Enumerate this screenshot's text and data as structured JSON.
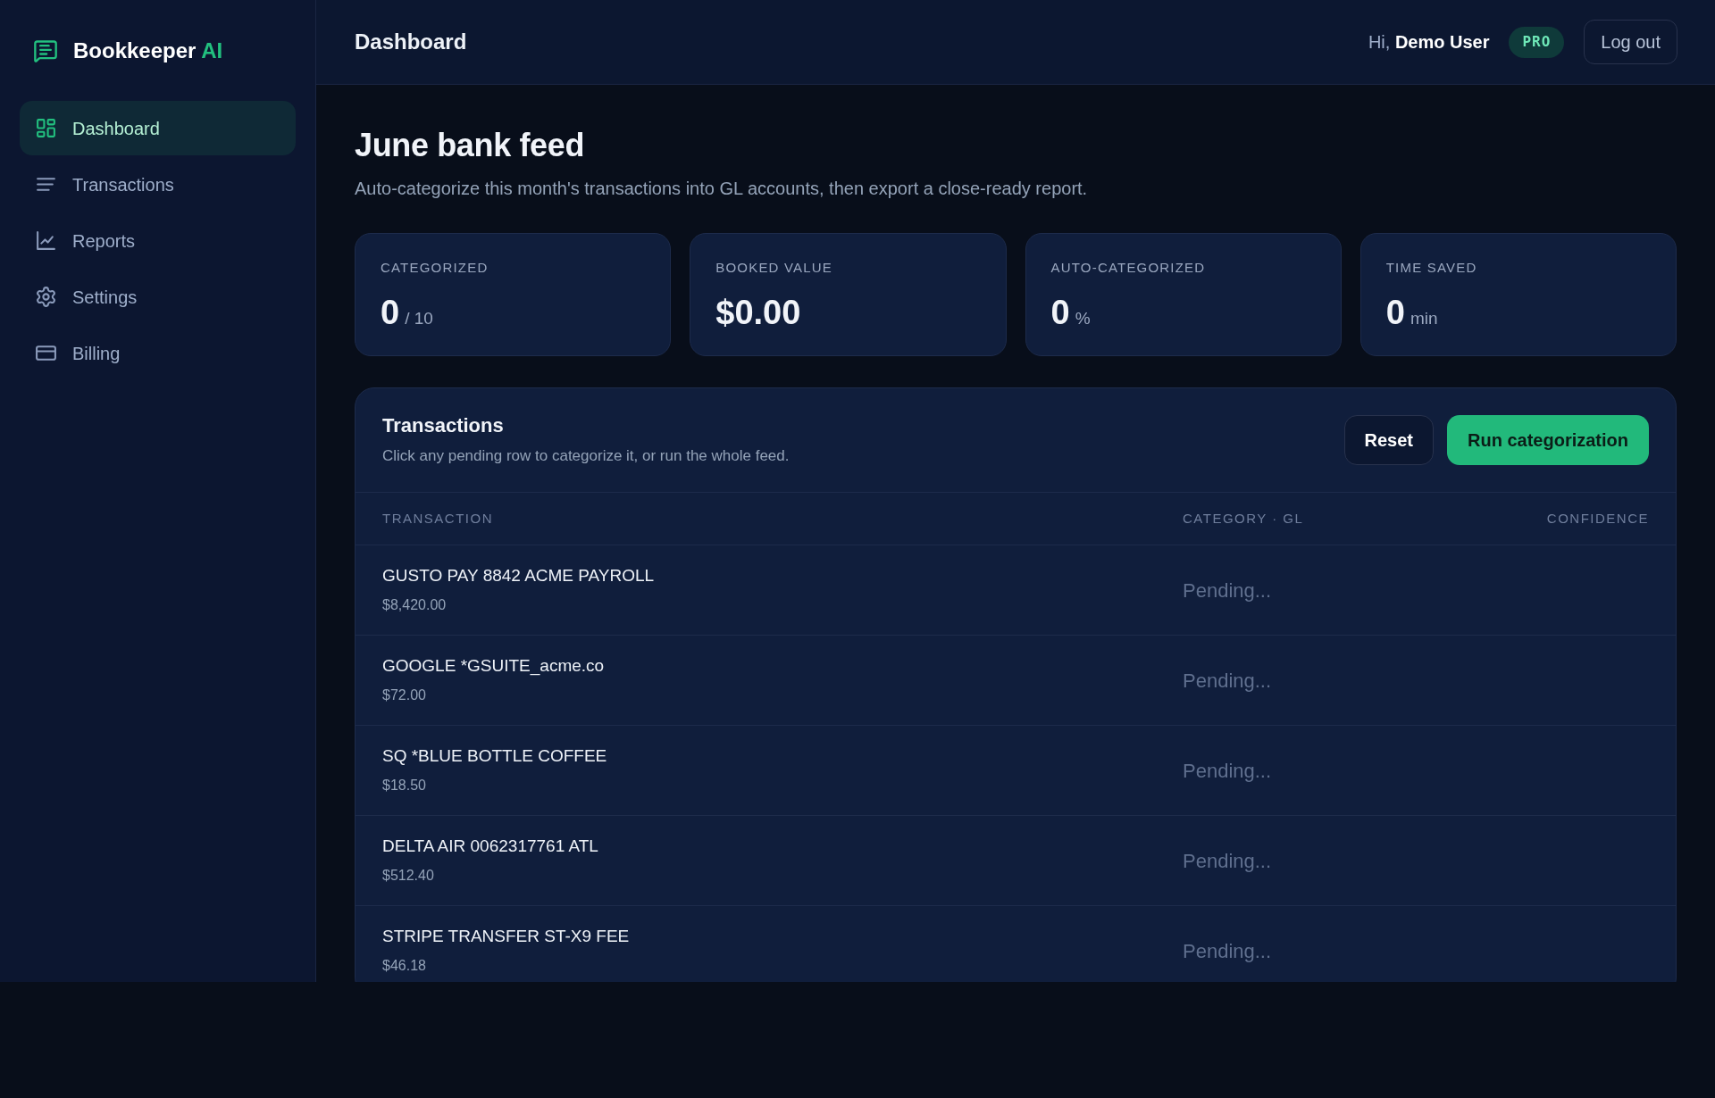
{
  "sidebar": {
    "brand": {
      "name": "Bookkeeper",
      "accent": "AI"
    },
    "items": [
      {
        "label": "Dashboard",
        "selected": true
      },
      {
        "label": "Transactions",
        "selected": false
      },
      {
        "label": "Reports",
        "selected": false
      },
      {
        "label": "Settings",
        "selected": false
      },
      {
        "label": "Billing",
        "selected": false
      }
    ]
  },
  "header": {
    "title": "Dashboard",
    "greeting": "Hi, **Demo User**",
    "plan_badge": "PRO",
    "logout_button": "Log out"
  },
  "page": {
    "title": "June bank feed",
    "subtitle": "Auto-categorize this month's transactions into GL accounts, then export a close-ready report."
  },
  "stats": [
    {
      "label": "CATEGORIZED",
      "value": "0",
      "unit": "/ 10"
    },
    {
      "label": "BOOKED VALUE",
      "value": "$0.00"
    },
    {
      "label": "AUTO-CATEGORIZED",
      "value": "0",
      "unit": "%"
    },
    {
      "label": "TIME SAVED",
      "value": "0",
      "unit": "min"
    }
  ],
  "transactions": {
    "title": "Transactions",
    "subtitle": "Click any pending row to categorize it, or run the whole feed.",
    "buttons": [
      {
        "label": "Reset",
        "kind": "outline"
      },
      {
        "label": "Run categorization",
        "kind": "primary"
      }
    ],
    "columns": [
      "TRANSACTION",
      "CATEGORY · GL",
      "CONFIDENCE"
    ],
    "rows": [
      {
        "description": "GUSTO PAY 8842 ACME PAYROLL",
        "amount": "$8,420.00",
        "category": "Pending..."
      },
      {
        "description": "GOOGLE *GSUITE_acme.co",
        "amount": "$72.00",
        "category": "Pending..."
      },
      {
        "description": "SQ *BLUE BOTTLE COFFEE",
        "amount": "$18.50",
        "category": "Pending..."
      },
      {
        "description": "DELTA AIR 0062317761 ATL",
        "amount": "$512.40",
        "category": "Pending..."
      },
      {
        "description": "STRIPE TRANSFER ST-X9 FEE",
        "amount": "$46.18",
        "category": "Pending..."
      }
    ]
  }
}
